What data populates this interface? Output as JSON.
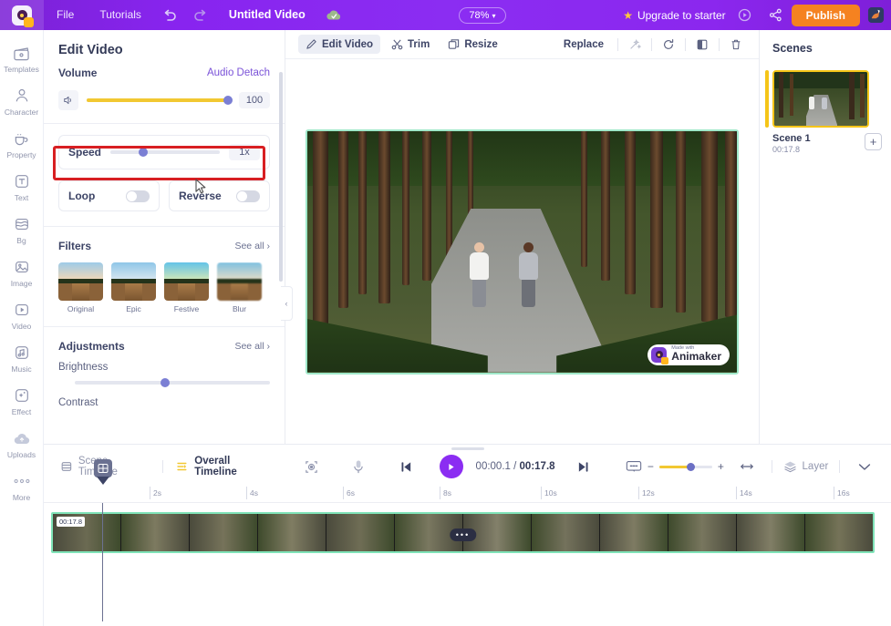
{
  "topbar": {
    "logo_name": "animaker-logo",
    "menu": [
      "File",
      "Tutorials"
    ],
    "undo_icon": "undo-icon",
    "redo_icon": "redo-icon",
    "project_title": "Untitled Video",
    "cloud_icon": "cloud-saved-icon",
    "zoom_level": "78%",
    "upgrade_label": "Upgrade to starter",
    "preview_icon": "preview-play-icon",
    "share_icon": "share-icon",
    "publish_label": "Publish",
    "avatar_icon": "user-avatar-icon"
  },
  "rail": {
    "items": [
      {
        "label": "Templates",
        "icon": "templates-icon"
      },
      {
        "label": "Character",
        "icon": "character-icon"
      },
      {
        "label": "Property",
        "icon": "property-icon"
      },
      {
        "label": "Text",
        "icon": "text-icon"
      },
      {
        "label": "Bg",
        "icon": "background-icon"
      },
      {
        "label": "Image",
        "icon": "image-icon"
      },
      {
        "label": "Video",
        "icon": "video-icon"
      },
      {
        "label": "Music",
        "icon": "music-icon"
      },
      {
        "label": "Effect",
        "icon": "effect-icon"
      },
      {
        "label": "Uploads",
        "icon": "uploads-cloud-icon"
      },
      {
        "label": "More",
        "icon": "more-dots-icon"
      }
    ]
  },
  "panel": {
    "title": "Edit Video",
    "volume_label": "Volume",
    "audio_detach_label": "Audio Detach",
    "volume_value": "100",
    "speed_label": "Speed",
    "speed_value": "1x",
    "loop_label": "Loop",
    "reverse_label": "Reverse",
    "filters_label": "Filters",
    "filters_see_all": "See all",
    "filters": [
      {
        "name": "Original"
      },
      {
        "name": "Epic"
      },
      {
        "name": "Festive"
      },
      {
        "name": "Blur"
      }
    ],
    "adjustments_label": "Adjustments",
    "adjustments_see_all": "See all",
    "brightness_label": "Brightness",
    "contrast_label": "Contrast"
  },
  "canvas_toolbar": {
    "edit_video_label": "Edit Video",
    "trim_label": "Trim",
    "resize_label": "Resize",
    "replace_label": "Replace",
    "magic_icon": "magic-wand-icon",
    "rotate_icon": "rotate-icon",
    "flip_icon": "flip-icon",
    "delete_icon": "trash-icon"
  },
  "canvas": {
    "watermark_top": "Made with",
    "watermark_name": "Animaker"
  },
  "scenes": {
    "title": "Scenes",
    "items": [
      {
        "name": "Scene 1",
        "duration": "00:17.8"
      }
    ],
    "add_label": "+"
  },
  "timeline": {
    "scene_timeline_label": "Scene Timeline",
    "overall_timeline_label": "Overall Timeline",
    "focus_icon": "focus-icon",
    "mic_icon": "microphone-icon",
    "prev_icon": "skip-back-icon",
    "play_icon": "play-icon",
    "current_time": "00:00.1",
    "time_separator": "/",
    "total_time": "00:17.8",
    "next_icon": "skip-forward-icon",
    "caption_icon": "caption-icon",
    "zoom_minus": "−",
    "zoom_plus": "+",
    "fit_icon": "fit-width-icon",
    "layer_label": "Layer",
    "layer_icon": "layers-icon",
    "chevron_icon": "chevron-down-icon",
    "ruler_ticks": [
      "2s",
      "4s",
      "6s",
      "8s",
      "10s",
      "12s",
      "14s",
      "16s"
    ],
    "clip_duration_label": "00:17.8",
    "clip_menu_icon": "clip-more-dots-icon",
    "playhead_label": "⊞"
  },
  "colors": {
    "brand_purple": "#8b2df2",
    "publish_orange": "#f58220",
    "highlight_red": "#d81f22",
    "slider_yellow": "#f2c832",
    "scene_yellow": "#f5c518",
    "clip_green": "#7fe3b8"
  }
}
